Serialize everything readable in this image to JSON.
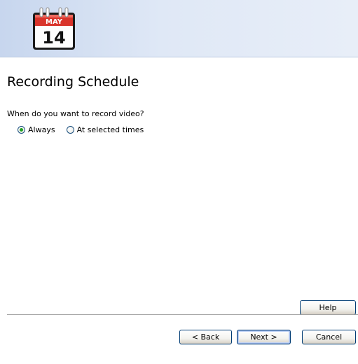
{
  "header": {
    "icon": "calendar-icon",
    "calendar_month": "MAY",
    "calendar_day": "14"
  },
  "main": {
    "title": "Recording Schedule",
    "question": "When do you want to record video?",
    "radio_options": [
      {
        "label": "Always",
        "checked": true
      },
      {
        "label": "At selected times",
        "checked": false
      }
    ]
  },
  "buttons": {
    "help": "Help",
    "back": "< Back",
    "next": "Next >",
    "cancel": "Cancel"
  },
  "colors": {
    "header_gradient_start": "#c7d6ee",
    "header_gradient_end": "#e8eef8",
    "calendar_red": "#d9342b",
    "radio_checked": "#21a121",
    "button_border": "#003c74"
  }
}
